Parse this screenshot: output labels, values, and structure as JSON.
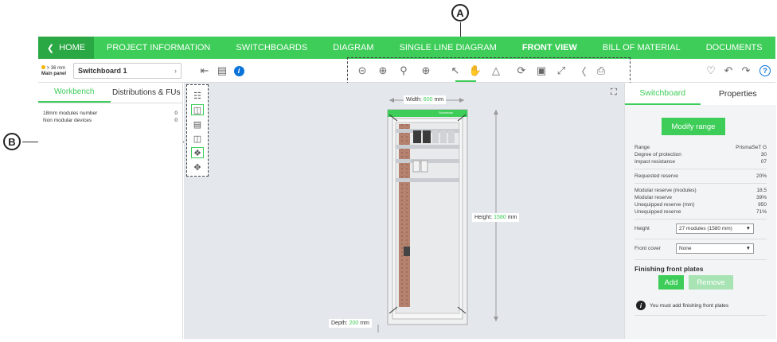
{
  "callouts": {
    "a": "A",
    "b": "B"
  },
  "nav": {
    "home": "HOME",
    "tabs": [
      "PROJECT INFORMATION",
      "SWITCHBOARDS",
      "DIAGRAM",
      "SINGLE LINE DIAGRAM",
      "FRONT VIEW",
      "BILL OF MATERIAL",
      "DOCUMENTS"
    ],
    "active_tab": "FRONT VIEW"
  },
  "panel": {
    "size": "> 36 mm",
    "name": "Main panel",
    "switchboard": "Switchboard 1"
  },
  "toolbar": {
    "left_icons": [
      "import-icon",
      "export-icon",
      "info-icon"
    ],
    "view_icons": [
      "zoom-out-icon",
      "zoom-in-icon",
      "zoom-fit-icon",
      "center-icon",
      "select-pointer-icon",
      "pan-hand-icon",
      "3d-view-icon",
      "refresh-icon",
      "camera-icon",
      "expand-icon",
      "label-icon",
      "print-icon"
    ],
    "right_icons": [
      "bell-icon",
      "undo-icon",
      "redo-icon",
      "help-icon"
    ]
  },
  "left_panel": {
    "tabs": [
      "Workbench",
      "Distributions & FUs"
    ],
    "rows": [
      {
        "label": "18mm modules number",
        "value": "0"
      },
      {
        "label": "Non modular devices",
        "value": "0"
      }
    ]
  },
  "side_tools": [
    "layout-icon",
    "device-icon",
    "list-icon",
    "book-icon",
    "tag-icon",
    "move-icon"
  ],
  "canvas": {
    "width_label": "Width:",
    "width_value": "600",
    "width_unit": "mm",
    "height_label": "Height:",
    "height_value": "1580",
    "height_unit": "mm",
    "depth_label": "Depth:",
    "depth_value": "200",
    "depth_unit": "mm",
    "brand": "Schneider"
  },
  "right_panel": {
    "tabs": [
      "Switchboard",
      "Properties"
    ],
    "modify_button": "Modify range",
    "range": [
      {
        "label": "Range",
        "value": "PrismaSeT G"
      },
      {
        "label": "Degree of protection",
        "value": "30"
      },
      {
        "label": "Impact resistance",
        "value": "07"
      }
    ],
    "requested": {
      "label": "Requested reserve",
      "value": "20%"
    },
    "reserves": [
      {
        "label": "Modular reserve (modules)",
        "value": "18.5"
      },
      {
        "label": "Modular reserve",
        "value": "39%"
      },
      {
        "label": "Unequipped reserve (mm)",
        "value": "950"
      },
      {
        "label": "Unequipped reserve",
        "value": "71%"
      }
    ],
    "height_label": "Height",
    "height_value": "27 modules (1580 mm)",
    "front_cover_label": "Front cover",
    "front_cover_value": "None",
    "finishing_title": "Finishing front plates",
    "add_button": "Add",
    "remove_button": "Remove",
    "notice": "You must add finishing front plates"
  },
  "colors": {
    "accent": "#3dcd58",
    "accent_dark": "#2aa843",
    "canvas_bg": "#e4e7ec",
    "info_blue": "#0a73d9"
  }
}
